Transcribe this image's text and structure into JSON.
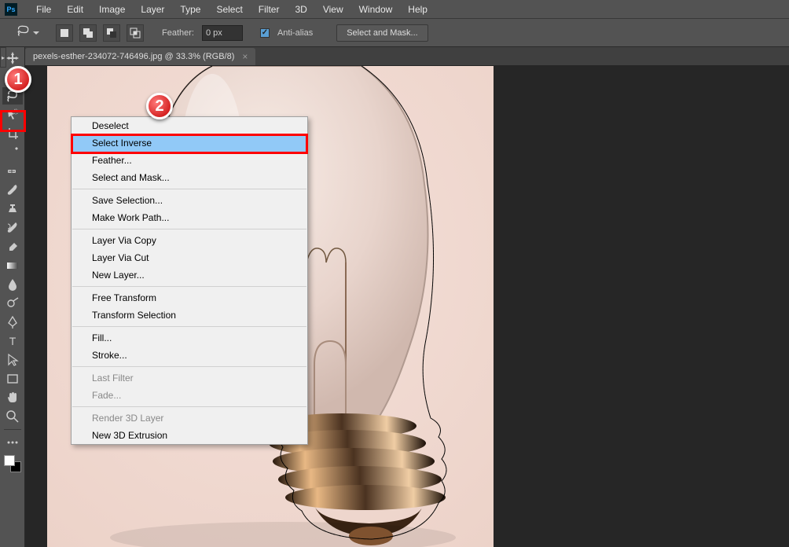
{
  "app": {
    "short": "Ps"
  },
  "menubar": [
    "File",
    "Edit",
    "Image",
    "Layer",
    "Type",
    "Select",
    "Filter",
    "3D",
    "View",
    "Window",
    "Help"
  ],
  "options": {
    "feather_label": "Feather:",
    "feather_value": "0 px",
    "antialias_label": "Anti-alias",
    "select_mask_btn": "Select and Mask..."
  },
  "tab": {
    "title": "pexels-esther-234072-746496.jpg @ 33.3% (RGB/8)",
    "close": "×"
  },
  "context_menu": {
    "items": [
      {
        "label": "Deselect",
        "kind": "item"
      },
      {
        "label": "Select Inverse",
        "kind": "item",
        "hover": true
      },
      {
        "label": "Feather...",
        "kind": "item"
      },
      {
        "label": "Select and Mask...",
        "kind": "item"
      },
      {
        "kind": "sep"
      },
      {
        "label": "Save Selection...",
        "kind": "item"
      },
      {
        "label": "Make Work Path...",
        "kind": "item"
      },
      {
        "kind": "sep"
      },
      {
        "label": "Layer Via Copy",
        "kind": "item"
      },
      {
        "label": "Layer Via Cut",
        "kind": "item"
      },
      {
        "label": "New Layer...",
        "kind": "item"
      },
      {
        "kind": "sep"
      },
      {
        "label": "Free Transform",
        "kind": "item"
      },
      {
        "label": "Transform Selection",
        "kind": "item"
      },
      {
        "kind": "sep"
      },
      {
        "label": "Fill...",
        "kind": "item"
      },
      {
        "label": "Stroke...",
        "kind": "item"
      },
      {
        "kind": "sep"
      },
      {
        "label": "Last Filter",
        "kind": "item",
        "disabled": true
      },
      {
        "label": "Fade...",
        "kind": "item",
        "disabled": true
      },
      {
        "kind": "sep"
      },
      {
        "label": "Render 3D Layer",
        "kind": "item",
        "disabled": true
      },
      {
        "label": "New 3D Extrusion",
        "kind": "item"
      }
    ]
  },
  "callouts": {
    "one": "1",
    "two": "2"
  }
}
